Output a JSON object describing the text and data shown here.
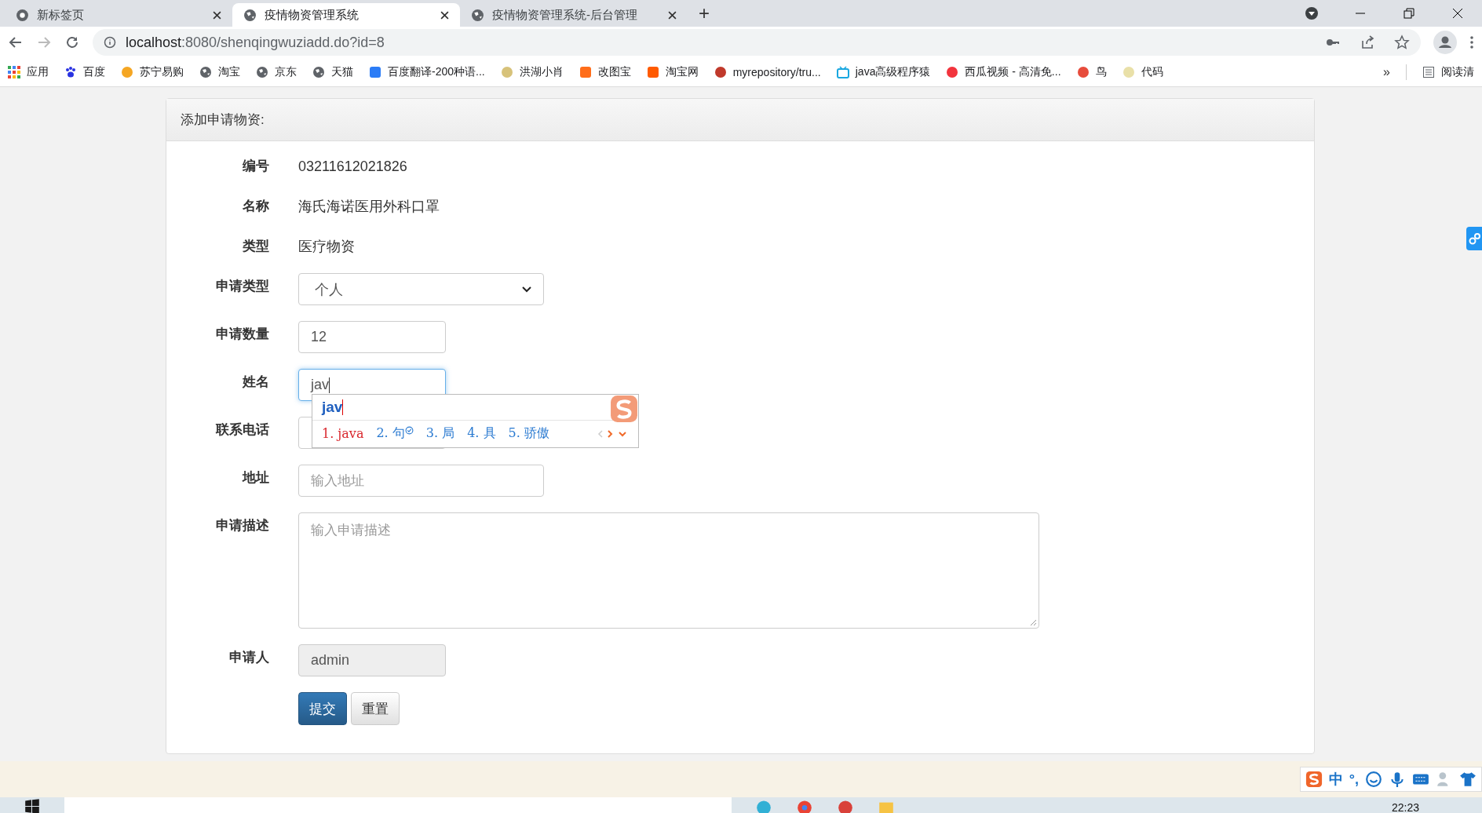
{
  "browser": {
    "tabs": [
      {
        "title": "新标签页",
        "selected": false,
        "kind": "chrome"
      },
      {
        "title": "疫情物资管理系统",
        "selected": true,
        "kind": "globe"
      },
      {
        "title": "疫情物资管理系统-后台管理",
        "selected": false,
        "kind": "globe"
      }
    ],
    "new_tab": "+",
    "url_host": "localhost",
    "url_rest": ":8080/shenqingwuziadd.do?id=8",
    "bookmarks": [
      {
        "label": "应用",
        "kind": "apps"
      },
      {
        "label": "百度",
        "kind": "paw",
        "color": "#2932e1"
      },
      {
        "label": "苏宁易购",
        "kind": "dot",
        "color": "#f5a623"
      },
      {
        "label": "淘宝",
        "kind": "globe"
      },
      {
        "label": "京东",
        "kind": "globe"
      },
      {
        "label": "天猫",
        "kind": "globe"
      },
      {
        "label": "百度翻译-200种语...",
        "kind": "square",
        "color": "#2b7cf6"
      },
      {
        "label": "洪湖小肖",
        "kind": "dot",
        "color": "#d7c27a"
      },
      {
        "label": "改图宝",
        "kind": "square",
        "color": "#ff6d1a"
      },
      {
        "label": "淘宝网",
        "kind": "square",
        "color": "#ff5a00"
      },
      {
        "label": "myrepository/tru...",
        "kind": "dot",
        "color": "#c0392b"
      },
      {
        "label": "java高级程序猿",
        "kind": "tv",
        "color": "#19a7e0"
      },
      {
        "label": "西瓜视频 - 高清免...",
        "kind": "dot",
        "color": "#f2343d"
      },
      {
        "label": "鸟",
        "kind": "dot",
        "color": "#e74c3c"
      },
      {
        "label": "代码",
        "kind": "dot",
        "color": "#e9e0a8"
      }
    ],
    "more": "»",
    "reading_list": "阅读清"
  },
  "form": {
    "title": "添加申请物资:",
    "fields": [
      {
        "label": "编号",
        "kind": "text",
        "value": "03211612021826"
      },
      {
        "label": "名称",
        "kind": "text",
        "value": "海氏海诺医用外科口罩"
      },
      {
        "label": "类型",
        "kind": "text",
        "value": "医疗物资"
      },
      {
        "label": "申请类型",
        "kind": "select",
        "value": "个人"
      },
      {
        "label": "申请数量",
        "kind": "input",
        "value": "12"
      },
      {
        "label": "姓名",
        "kind": "input",
        "value": "jav",
        "focused": true
      },
      {
        "label": "联系电话",
        "kind": "input"
      },
      {
        "label": "地址",
        "kind": "wide",
        "placeholder": "输入地址"
      },
      {
        "label": "申请描述",
        "kind": "textarea",
        "placeholder": "输入申请描述"
      },
      {
        "label": "申请人",
        "kind": "readonly",
        "value": "admin"
      }
    ],
    "buttons": [
      {
        "label": "提交",
        "kind": "primary"
      },
      {
        "label": "重置",
        "kind": "default"
      }
    ]
  },
  "ime": {
    "composition": "jav",
    "candidates": [
      {
        "label": "1. java",
        "selected": true,
        "verified": false
      },
      {
        "label": "2. 句",
        "selected": false,
        "verified": true
      },
      {
        "label": "3. 局",
        "selected": false,
        "verified": false
      },
      {
        "label": "4. 具",
        "selected": false,
        "verified": false
      },
      {
        "label": "5. 骄傲",
        "selected": false,
        "verified": false
      }
    ],
    "status": [
      "中",
      "°,"
    ]
  },
  "taskbar": {
    "clock": "22:23"
  }
}
